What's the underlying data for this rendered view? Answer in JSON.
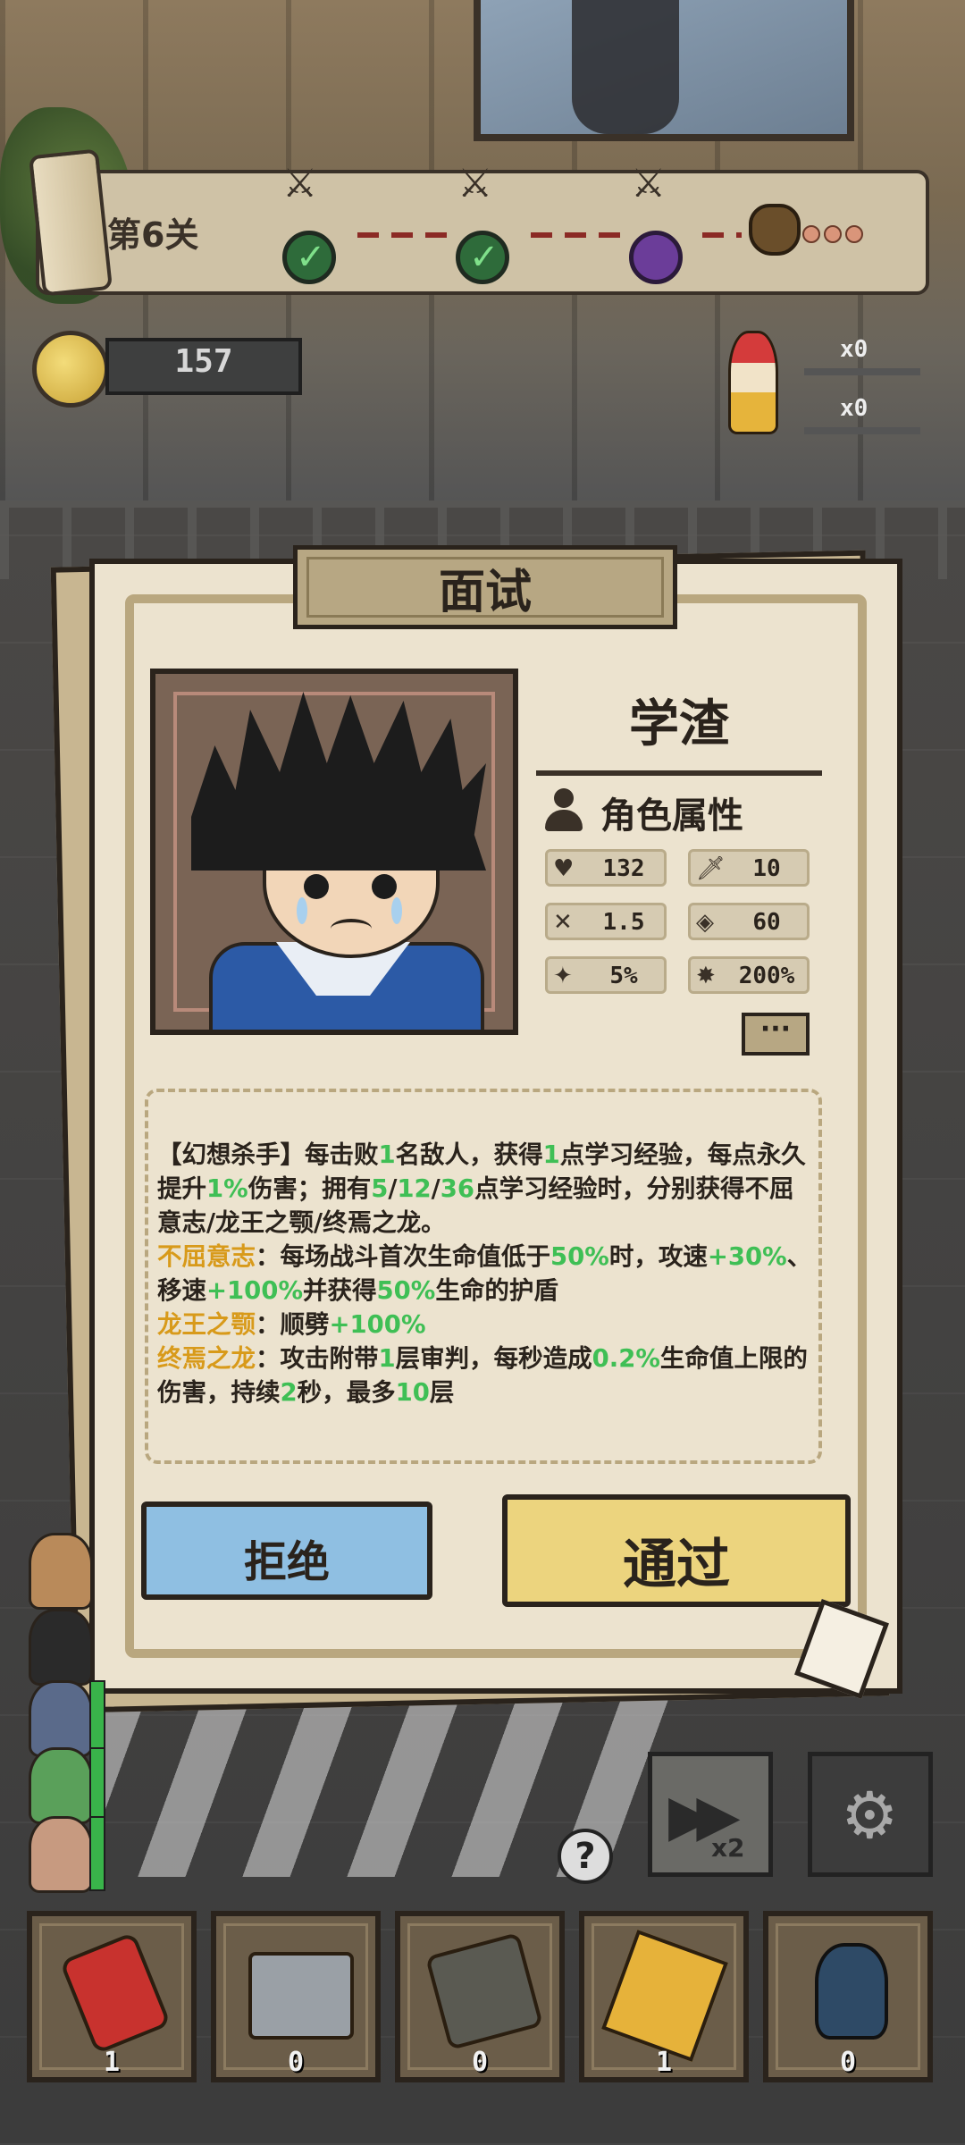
{
  "hud": {
    "level_label": "第6关",
    "coin_count": "157",
    "enemy_counters": [
      "x0",
      "x0"
    ]
  },
  "dialog": {
    "title": "面试",
    "character_name": "学渣",
    "attributes_title": "角色属性",
    "stats": [
      {
        "icon": "heart-icon",
        "value": "132"
      },
      {
        "icon": "sword-icon",
        "value": "10"
      },
      {
        "icon": "attack-speed-icon",
        "value": "1.5"
      },
      {
        "icon": "range-icon",
        "value": "60"
      },
      {
        "icon": "crit-icon",
        "value": "5%"
      },
      {
        "icon": "crit-damage-icon",
        "value": "200%"
      }
    ],
    "more_label": "···",
    "description": {
      "p1_a": "【幻想杀手】每击败",
      "p1_n1": "1",
      "p1_b": "名敌人，获得",
      "p1_n2": "1",
      "p1_c": "点学习经验，每点永久提升",
      "p1_n3": "1%",
      "p1_d": "伤害；拥有",
      "p1_n4": "5",
      "p1_s1": "/",
      "p1_n5": "12",
      "p1_s2": "/",
      "p1_n6": "36",
      "p1_e": "点学习经验时，分别获得不屈意志/龙王之颚/终焉之龙。",
      "p2_name": "不屈意志",
      "p2_a": "：每场战斗首次生命值低于",
      "p2_n1": "50%",
      "p2_b": "时，攻速",
      "p2_n2": "+30%",
      "p2_c": "、移速",
      "p2_n3": "+100%",
      "p2_d": "并获得",
      "p2_n4": "50%",
      "p2_e": "生命的护盾",
      "p3_name": "龙王之颚",
      "p3_a": "：顺劈",
      "p3_n1": "+100%",
      "p4_name": "终焉之龙",
      "p4_a": "：攻击附带",
      "p4_n1": "1",
      "p4_b": "层审判，每秒造成",
      "p4_n2": "0.2%",
      "p4_c": "生命值上限的伤害，持续",
      "p4_n3": "2",
      "p4_d": "秒，最多",
      "p4_n4": "10",
      "p4_e": "层"
    },
    "reject_label": "拒绝",
    "pass_label": "通过"
  },
  "controls": {
    "speed_label": "x2",
    "help_label": "?"
  },
  "items": [
    {
      "icon": "cola-can-icon",
      "count": "1"
    },
    {
      "icon": "first-aid-kit-icon",
      "count": "0"
    },
    {
      "icon": "scroll-map-icon",
      "count": "0"
    },
    {
      "icon": "lightning-talisman-icon",
      "count": "1"
    },
    {
      "icon": "bomb-icon",
      "count": "0"
    }
  ],
  "colors": {
    "highlight_green": "#3fbf55",
    "highlight_orange": "#d89a1a",
    "reject_blue": "#8fbfe2",
    "pass_yellow": "#ecd47e"
  }
}
